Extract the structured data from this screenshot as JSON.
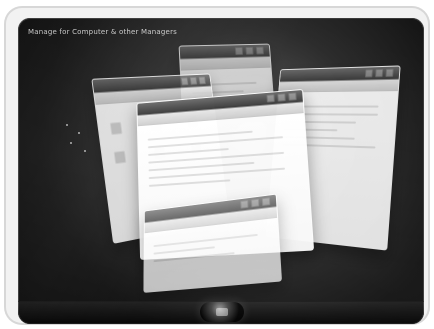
{
  "desktop": {
    "top_text": "Manage for Computer & other Managers"
  },
  "windows": [
    {
      "id": "win-back-top",
      "title": ""
    },
    {
      "id": "win-left-mid",
      "title": ""
    },
    {
      "id": "win-right",
      "title": ""
    },
    {
      "id": "win-center",
      "title": ""
    },
    {
      "id": "win-bottom",
      "title": ""
    }
  ],
  "taskbar": {
    "start_button_label": ""
  },
  "colors": {
    "background_dark": "#0a0a0a",
    "window_white": "#fafafa",
    "titlebar_gray": "#4a4a4a"
  }
}
